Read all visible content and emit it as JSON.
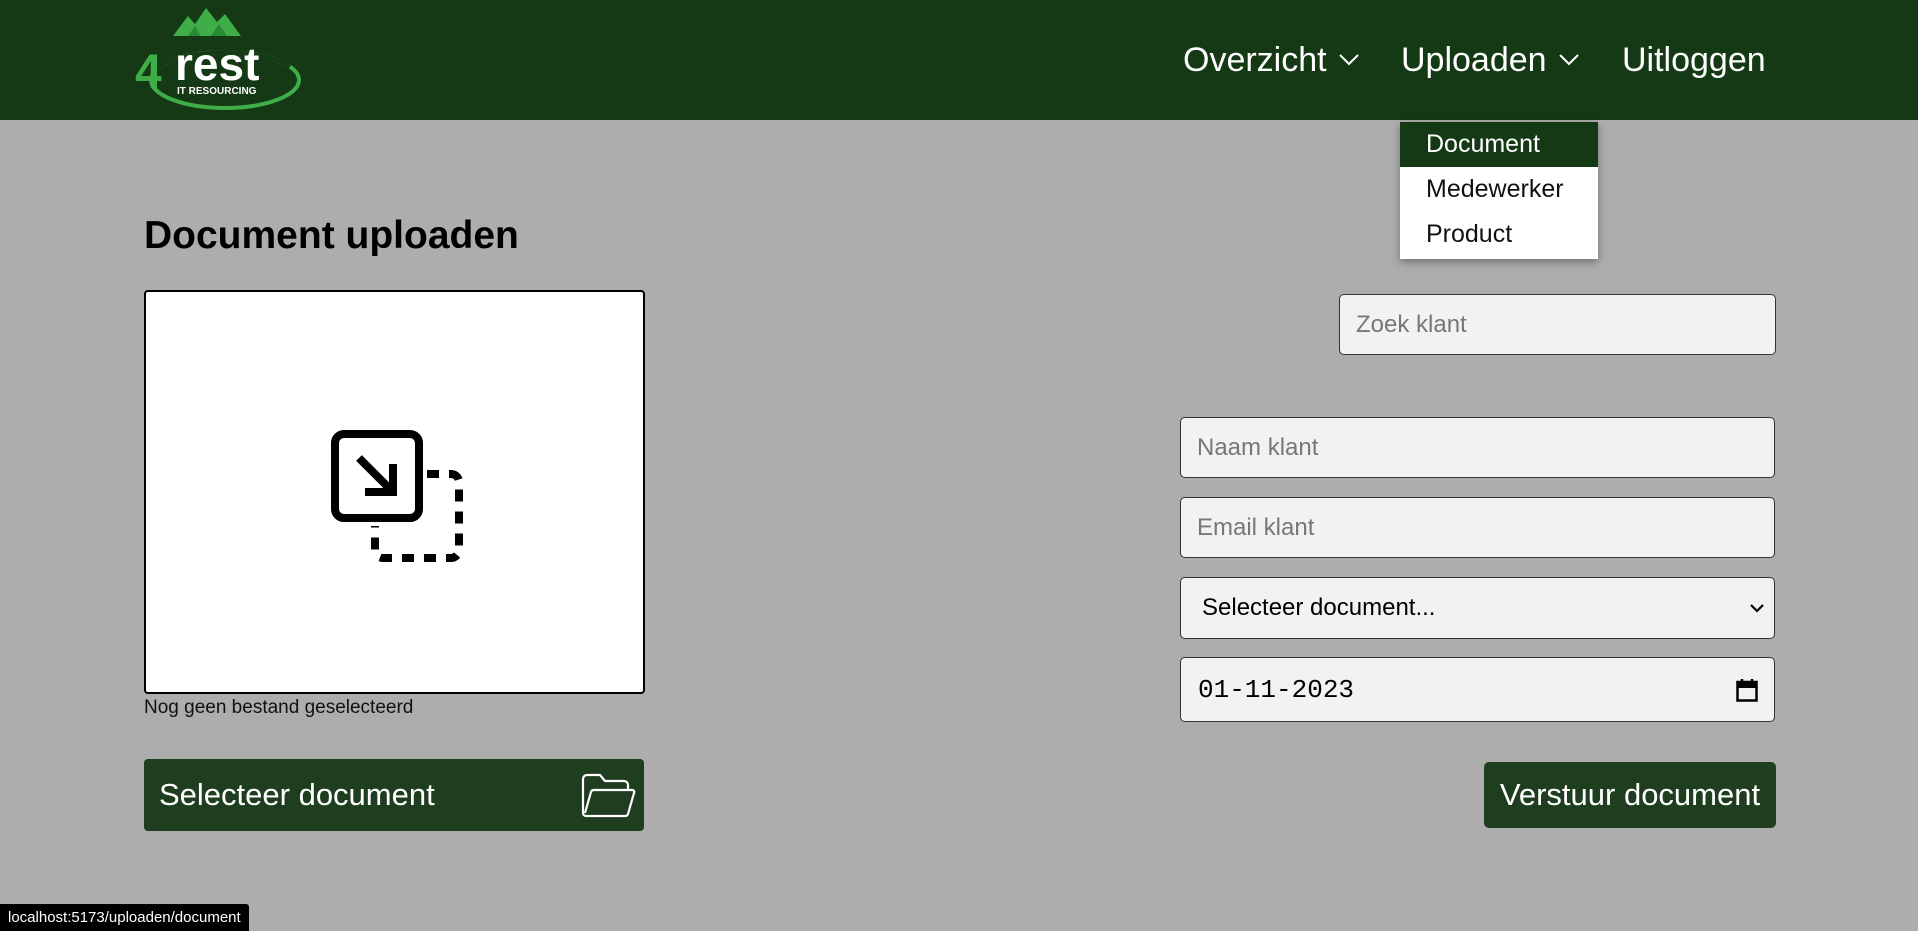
{
  "colors": {
    "nav_bg": "#153915",
    "button_bg": "#1f3d1f",
    "page_bg": "#adadad",
    "logo_green": "#3fae49"
  },
  "logo": {
    "brand": "4rest",
    "tagline": "IT RESOURCING"
  },
  "nav": {
    "items": [
      {
        "label": "Overzicht",
        "icon": "chevron-down-icon"
      },
      {
        "label": "Uploaden",
        "icon": "chevron-down-icon"
      },
      {
        "label": "Uitloggen"
      }
    ]
  },
  "dropdown": {
    "items": [
      {
        "label": "Document",
        "active": true
      },
      {
        "label": "Medewerker"
      },
      {
        "label": "Product"
      }
    ]
  },
  "page": {
    "title": "Document uploaden",
    "dropzone_icon": "move-file-icon",
    "file_status": "Nog geen bestand geselecteerd",
    "select_button": "Selecteer document",
    "select_button_icon": "folder-icon"
  },
  "form": {
    "search_placeholder": "Zoek klant",
    "name_placeholder": "Naam klant",
    "email_placeholder": "Email klant",
    "document_select": "Selecteer document...",
    "date_value": "01-11-2023",
    "date_icon": "calendar-icon",
    "submit_label": "Verstuur document"
  },
  "status_bar": {
    "url": "localhost:5173/uploaden/document"
  }
}
